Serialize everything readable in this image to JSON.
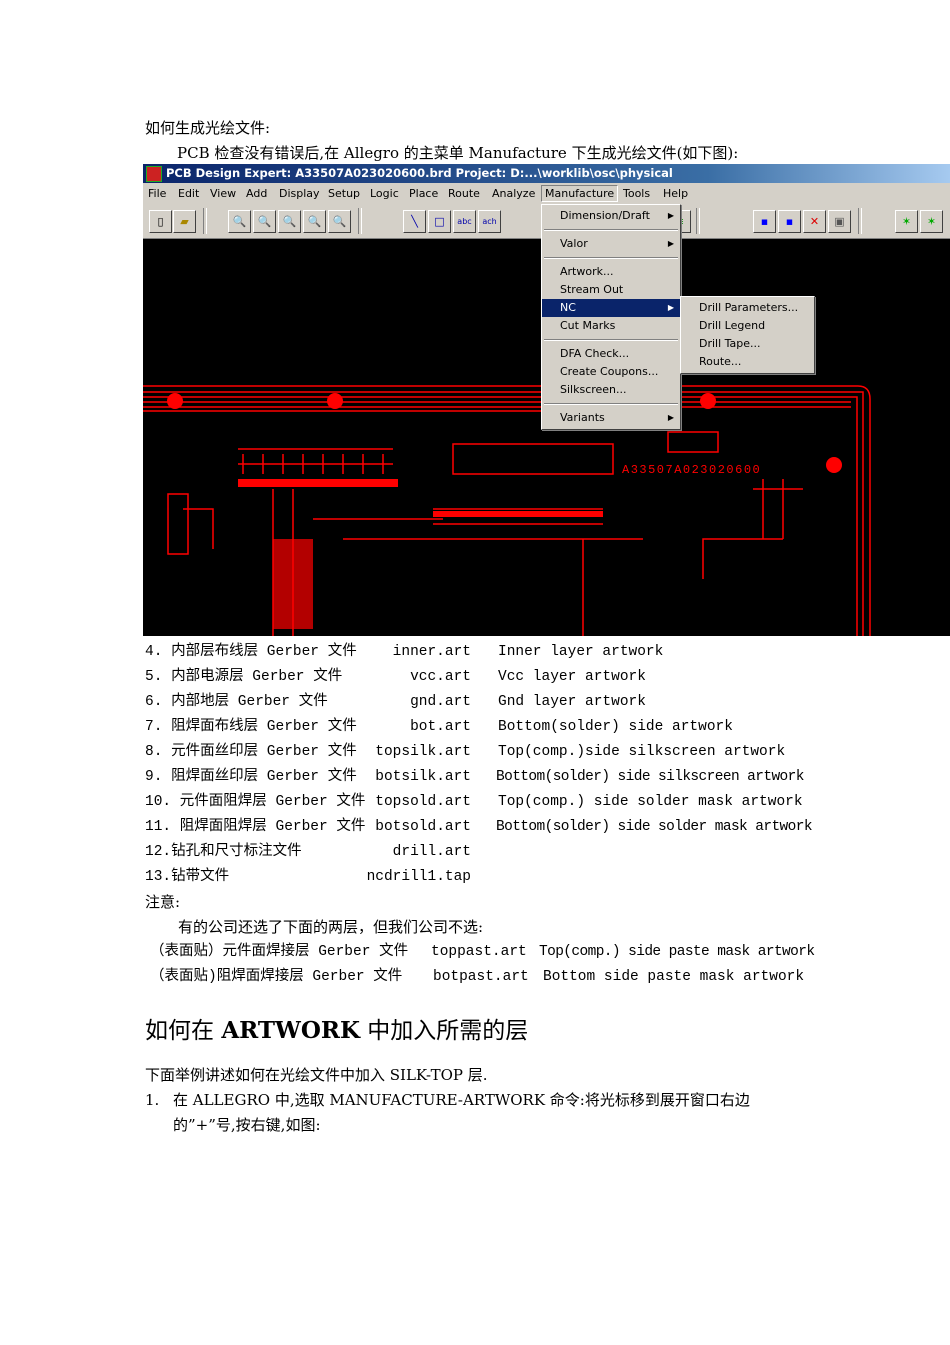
{
  "intro": {
    "heading": "如何生成光绘文件:",
    "line": "PCB 检查没有错误后,在 Allegro 的主菜单 Manufacture 下生成光绘文件(如下图):"
  },
  "app": {
    "title": "PCB Design Expert: A33507A023020600.brd  Project: D:...\\worklib\\osc\\physical",
    "menus": [
      "File",
      "Edit",
      "View",
      "Add",
      "Display",
      "Setup",
      "Logic",
      "Place",
      "Route",
      "Analyze",
      "Manufacture",
      "Tools",
      "Help"
    ],
    "manufacture_menu": [
      "Dimension/Draft",
      "Valor",
      "Artwork...",
      "Stream Out",
      "NC",
      "Cut Marks",
      "DFA Check...",
      "Create Coupons...",
      "Silkscreen...",
      "Variants"
    ],
    "nc_submenu": [
      "Drill Parameters...",
      "Drill Legend",
      "Drill Tape...",
      "Route..."
    ],
    "board_label": "A33507A023020600"
  },
  "layers": [
    {
      "name": "4. 内部层布线层 Gerber 文件",
      "file": "inner.art",
      "desc": "Inner  layer  artwork"
    },
    {
      "name": "5. 内部电源层 Gerber 文件",
      "file": "vcc.art",
      "desc": "Vcc  layer  artwork"
    },
    {
      "name": "6. 内部地层 Gerber 文件",
      "file": "gnd.art",
      "desc": "Gnd  layer  artwork"
    },
    {
      "name": "7. 阻焊面布线层 Gerber 文件",
      "file": "bot.art",
      "desc": "Bottom(solder)  side  artwork"
    },
    {
      "name": "8. 元件面丝印层 Gerber 文件",
      "file": "topsilk.art",
      "desc": "Top(comp.)side  silkscreen  artwork"
    },
    {
      "name": "9. 阻焊面丝印层 Gerber 文件",
      "file": "botsilk.art",
      "desc": "Bottom(solder) side silkscreen artwork"
    },
    {
      "name": "10. 元件面阻焊层 Gerber 文件",
      "file": "topsold.art",
      "desc": "Top(comp.)  side  solder  mask  artwork"
    },
    {
      "name": "11. 阻焊面阻焊层 Gerber 文件",
      "file": "botsold.art",
      "desc": "Bottom(solder) side solder mask artwork"
    },
    {
      "name": "12.钻孔和尺寸标注文件",
      "file": "drill.art",
      "desc": ""
    },
    {
      "name": "13.钻带文件",
      "file": "ncdrill1.tap",
      "desc": ""
    }
  ],
  "note": {
    "label": "注意:",
    "text": "有的公司还选了下面的两层，但我们公司不选:",
    "rows": [
      {
        "name": "（表面贴）元件面焊接层 Gerber 文件",
        "file": "toppast.art",
        "desc": "Top(comp.) side paste mask artwork"
      },
      {
        "name": "（表面贴)阻焊面焊接层 Gerber 文件",
        "file": "botpast.art",
        "desc": "Bottom  side  paste  mask  artwork"
      }
    ]
  },
  "section": {
    "title_pre": "如何在 ",
    "title_bold": "ARTWORK",
    "title_post": " 中加入所需的层",
    "p1": "下面举例讲述如何在光绘文件中加入 SILK-TOP  层.",
    "step_num": "1.",
    "step_line1": "在  ALLEGRO  中,选取  MANUFACTURE-ARTWORK  命令:将光标移到展开窗口右边",
    "step_line2": "的”+”号,按右键,如图:"
  },
  "colors": {
    "board": "#ff0000",
    "canvas": "#000000",
    "menu": "#d4d0c8",
    "highlight": "#0a246a"
  }
}
